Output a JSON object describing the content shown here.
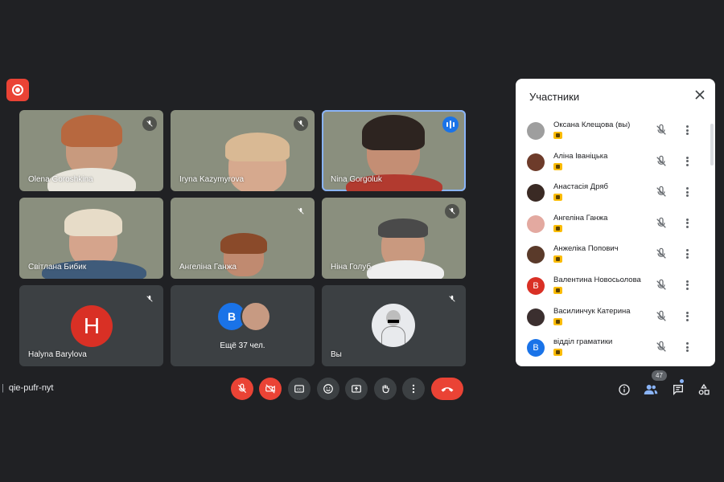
{
  "tiles": [
    {
      "name": "Olena Goroshkina"
    },
    {
      "name": "Iryna Kazymyrova"
    },
    {
      "name": "Nina Gorgoluk"
    },
    {
      "name": "Світлана Бибик"
    },
    {
      "name": "Ангеліна Ганжа"
    },
    {
      "name": "Ніна Голуб"
    },
    {
      "name": "Halyna Barylova",
      "initial": "H"
    },
    {
      "more_text": "Ещё 37 чел.",
      "initial": "B"
    },
    {
      "name": "Вы"
    }
  ],
  "panel": {
    "title": "Участники",
    "participants": [
      {
        "name": "Оксана Клещова (вы)",
        "initial": ""
      },
      {
        "name": "Аліна Іваніцька",
        "initial": ""
      },
      {
        "name": "Анастасія Дряб",
        "initial": ""
      },
      {
        "name": "Ангеліна Ганжа",
        "initial": ""
      },
      {
        "name": "Анжеліка Попович",
        "initial": ""
      },
      {
        "name": "Валентина Новосьолова",
        "initial": "В"
      },
      {
        "name": "Василинчук Катерина",
        "initial": ""
      },
      {
        "name": "відділ граматики",
        "initial": "В"
      }
    ]
  },
  "meeting_code": "qie-pufr-nyt",
  "participant_count": "47",
  "colors": {
    "background": "#202124",
    "tile": "#3c4043",
    "danger": "#ea4335",
    "accent": "#1a73e8",
    "badge": "#fbbc04"
  },
  "icons": [
    "record-icon",
    "mic-off-icon",
    "speaking-icon",
    "close-icon",
    "more-vert-icon",
    "camera-off-icon",
    "captions-icon",
    "emoji-icon",
    "present-icon",
    "raise-hand-icon",
    "end-call-icon",
    "info-icon",
    "people-icon",
    "chat-icon",
    "activities-icon"
  ]
}
